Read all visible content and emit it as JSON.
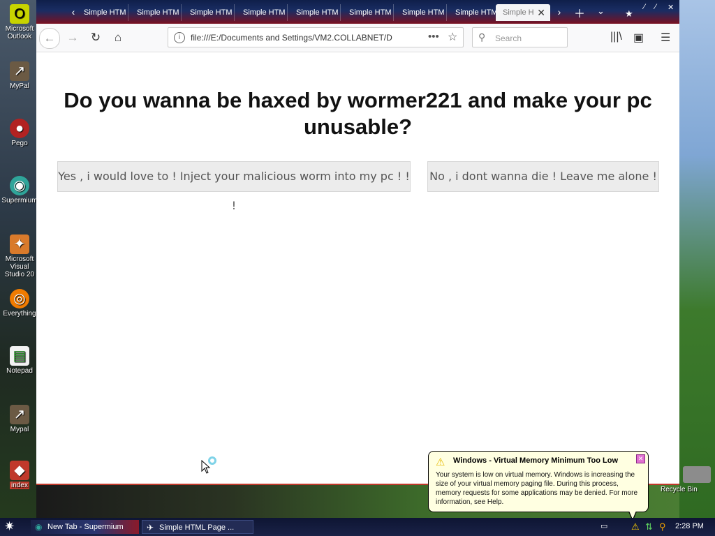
{
  "desktop": {
    "left_icons": [
      {
        "label": "Microsoft Outlook",
        "icon": "outlook-icon"
      },
      {
        "label": "MyPal",
        "icon": "shortcut-icon"
      },
      {
        "label": "Pego",
        "icon": "pego-icon"
      },
      {
        "label": "Supermium",
        "icon": "supermium-icon"
      },
      {
        "label": "Microsoft Visual Studio 20",
        "icon": "visual-studio-icon"
      },
      {
        "label": "Everything",
        "icon": "everything-icon"
      },
      {
        "label": "Notepad",
        "icon": "notepad-icon"
      },
      {
        "label": "Mypal",
        "icon": "shortcut-icon"
      },
      {
        "label": "index",
        "icon": "html-file-icon"
      }
    ],
    "recycle_bin_label": "Recycle Bin"
  },
  "browser": {
    "tabs": [
      {
        "label": "Simple HTM"
      },
      {
        "label": "Simple HTM"
      },
      {
        "label": "Simple HTM"
      },
      {
        "label": "Simple HTM"
      },
      {
        "label": "Simple HTM"
      },
      {
        "label": "Simple HTM"
      },
      {
        "label": "Simple HTM"
      },
      {
        "label": "Simple HTM"
      },
      {
        "label": "Simple H",
        "active": true
      }
    ],
    "url": "file:///E:/Documents and Settings/VM2.COLLABNET/D",
    "search_placeholder": "Search",
    "icons": {
      "back": "back-arrow-icon",
      "forward": "forward-arrow-icon",
      "reload": "reload-icon",
      "home": "home-icon",
      "library": "library-icon",
      "sidebar": "sidebar-icon",
      "menu": "hamburger-menu-icon"
    }
  },
  "page": {
    "headline": "Do you wanna be haxed by wormer221 and make your pc unusable?",
    "yes_button": "Yes , i would love to ! Inject your malicious worm into my pc ! ! !",
    "no_button": "No , i dont wanna die ! Leave me alone !"
  },
  "notification": {
    "title": "Windows - Virtual Memory Minimum Too Low",
    "body": "Your system is low on virtual memory. Windows is increasing the size of your virtual memory paging file. During this process, memory requests for some applications may be denied. For more information, see Help."
  },
  "taskbar": {
    "tasks": [
      {
        "label": "New Tab - Supermium",
        "icon": "supermium-icon"
      },
      {
        "label": "Simple HTML Page ...",
        "icon": "browser-icon"
      }
    ],
    "clock": "2:28 PM"
  },
  "colors": {
    "tabstrip_top": "#0f1f4a",
    "tabstrip_bottom": "#7a1020",
    "taskbar": "#131b3d",
    "balloon": "#ffffe1"
  }
}
